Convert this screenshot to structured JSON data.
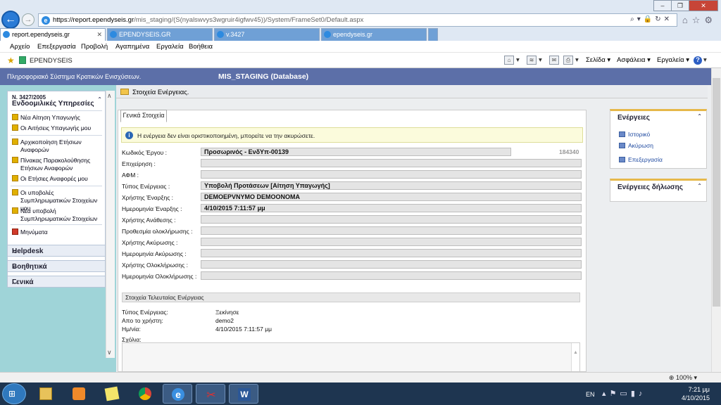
{
  "browser": {
    "url_host": "https://report.ependyseis.gr",
    "url_path": "/mis_staging/(S(nyalswvys3wgruir4igfwv45))/System/FrameSet0/Default.aspx",
    "tabs": [
      {
        "label": "report.ependyseis.gr",
        "active": true
      },
      {
        "label": "EPENDYSEIS.GR",
        "active": false
      },
      {
        "label": "v.3427",
        "active": false
      },
      {
        "label": "ependyseis.gr",
        "active": false
      }
    ],
    "menu": [
      "Αρχείο",
      "Επεξεργασία",
      "Προβολή",
      "Αγαπημένα",
      "Εργαλεία",
      "Βοήθεια"
    ],
    "favorite_label": "EPENDYSEIS",
    "commands": {
      "page": "Σελίδα",
      "safety": "Ασφάλεια",
      "tools": "Εργαλεία"
    },
    "zoom": "100%"
  },
  "app": {
    "header_left": "Πληροφοριακό Σύστημα Κρατικών Ενισχύσεων.",
    "header_center": "MIS_STAGING (Database)"
  },
  "leftnav": {
    "code": "Ν. 3427/2005",
    "title": "Ενδοομιλικές Υπηρεσίες",
    "items": [
      "Νέα Αίτηση Υπαγωγής",
      "Οι Αιτήσεις Υπαγωγής μου",
      "Αρχικοποίηση Ετήσιων Αναφορών",
      "Πίνακας Παρακολούθησης Ετήσιων Αναφορών",
      "Οι Ετήσιες Αναφορές μου",
      "Οι υποβολές Συμπληρωματικών Στοιχείων μου",
      "Νέα υποβολή Συμπληρωματικών Στοιχείων",
      "Μηνύματα"
    ],
    "sections": [
      "Helpdesk",
      "Βοηθητικά",
      "Γενικά"
    ]
  },
  "content": {
    "header": "Στοιχεία Ενέργειας.",
    "tab_label": "Γενικά Στοιχεία",
    "info": "Η ενέργεια δεν είναι οριστικοποιημένη, μπορείτε να την ακυρώσετε.",
    "record_id": "184340",
    "fields": [
      {
        "label": "Κωδικός Έργου :",
        "value": "Προσωρινός - ΕνδΥπ-00139"
      },
      {
        "label": "Επιχείρηση :",
        "value": ""
      },
      {
        "label": "ΑΦΜ :",
        "value": ""
      },
      {
        "label": "Τύπος Ενέργειας :",
        "value": "Υποβολή Προτάσεων [Αίτηση Υπαγωγής]"
      },
      {
        "label": "Χρήστης Έναρξης :",
        "value": "DEMOEPVNYMO DEMOONOMA"
      },
      {
        "label": "Ημερομηνία Έναρξης :",
        "value": "4/10/2015 7:11:57 μμ"
      },
      {
        "label": "Χρήστης Ανάθεσης :",
        "value": ""
      },
      {
        "label": "Προθεσμία ολοκλήρωσης :",
        "value": ""
      },
      {
        "label": "Χρήστης Ακύρωσης :",
        "value": ""
      },
      {
        "label": "Ημερομηνία Ακύρωσης :",
        "value": ""
      },
      {
        "label": "Χρήστης Ολοκλήρωσης :",
        "value": ""
      },
      {
        "label": "Ημερομηνία Ολοκλήρωσης :",
        "value": ""
      }
    ],
    "last_action": {
      "title": "Στοιχεία Τελευταίας Ενέργειας",
      "rows": [
        {
          "label": "Τύπος Ενέργειας:",
          "value": "Ξεκίνησε"
        },
        {
          "label": "Απο το χρήστη:",
          "value": "demo2"
        },
        {
          "label": "Ημ/νία:",
          "value": "4/10/2015 7:11:57 μμ"
        }
      ],
      "comments_label": "Σχόλια:"
    }
  },
  "actions_panel": {
    "title": "Ενέργειες",
    "links": [
      "Ιστορικό",
      "Ακύρωση",
      "Επεξεργασία"
    ]
  },
  "declaration_panel": {
    "title": "Ενέργειες δήλωσης"
  },
  "taskbar": {
    "lang": "EN",
    "time": "7:21 μμ",
    "date": "4/10/2015"
  }
}
